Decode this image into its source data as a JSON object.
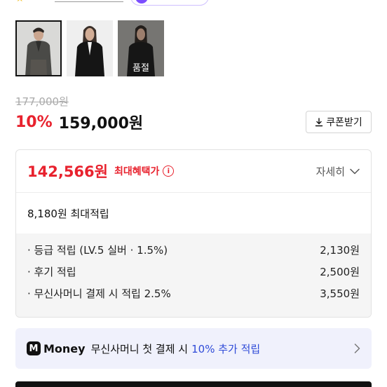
{
  "thumbnails": [
    {
      "name": "thumb-1",
      "selected": true,
      "sold_out": false
    },
    {
      "name": "thumb-2",
      "selected": false,
      "sold_out": false
    },
    {
      "name": "thumb-3",
      "selected": false,
      "sold_out": true,
      "sold_out_label": "품절"
    }
  ],
  "pricing": {
    "original_price": "177,000원",
    "discount_rate": "10%",
    "sale_price": "159,000원",
    "coupon_label": "쿠폰받기"
  },
  "benefit": {
    "max_price": "142,566원",
    "max_label": "최대혜택가",
    "info_icon": "i",
    "detail_label": "자세히",
    "points_summary": "8,180원 최대적립",
    "breakdown": [
      {
        "label": "· 등급 적립 (LV.5 실버 · 1.5%)",
        "value": "2,130원"
      },
      {
        "label": "· 후기 적립",
        "value": "2,500원"
      },
      {
        "label": "· 무신사머니 결제 시 적립 2.5%",
        "value": "3,550원"
      }
    ]
  },
  "money_banner": {
    "logo_letter": "M",
    "brand": "Money",
    "text": "무신사머니 첫 결제 시",
    "highlight": "10% 추가 적립"
  },
  "colors": {
    "accent_red": "#e8222e",
    "accent_blue": "#2f4bd8",
    "banner_bg": "#f0f1fc"
  }
}
